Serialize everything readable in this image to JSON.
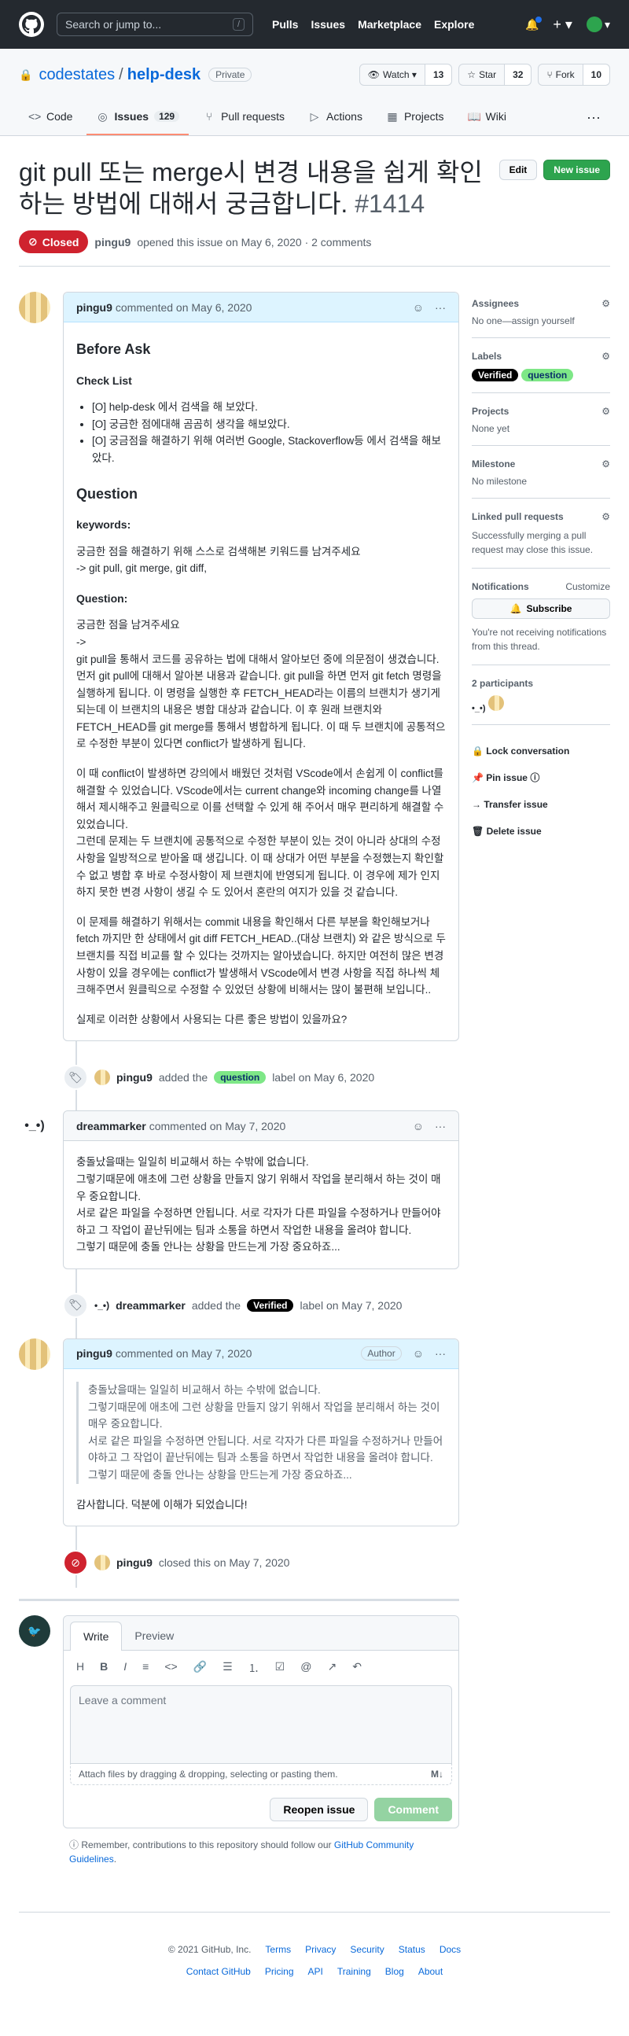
{
  "topbar": {
    "search_placeholder": "Search or jump to...",
    "slash": "/",
    "nav": [
      "Pulls",
      "Issues",
      "Marketplace",
      "Explore"
    ]
  },
  "repo": {
    "owner": "codestates",
    "sep": "/",
    "name": "help-desk",
    "visibility": "Private",
    "watch_label": "Watch",
    "watch_count": "13",
    "star_label": "Star",
    "star_count": "32",
    "fork_label": "Fork",
    "fork_count": "10",
    "tabs": [
      {
        "label": "Code",
        "icon": "<>"
      },
      {
        "label": "Issues",
        "icon": "◎",
        "count": "129"
      },
      {
        "label": "Pull requests",
        "icon": "⑂"
      },
      {
        "label": "Actions",
        "icon": "▷"
      },
      {
        "label": "Projects",
        "icon": "▦"
      },
      {
        "label": "Wiki",
        "icon": "📖"
      }
    ]
  },
  "issue": {
    "title": "git pull 또는 merge시 변경 내용을 쉽게 확인하는 방법에 대해서 궁금합니다.",
    "number": "#1414",
    "edit_label": "Edit",
    "new_label": "New issue",
    "state": "Closed",
    "author": "pingu9",
    "meta": "opened this issue on May 6, 2020 · 2 comments"
  },
  "comments": {
    "c1": {
      "author": "pingu9",
      "date": "commented on May 6, 2020",
      "h_before": "Before Ask",
      "h_check": "Check List",
      "checks": [
        "[O] help-desk 에서 검색을 해 보았다.",
        "[O] 궁금한 점에대해 곰곰히 생각을 해보았다.",
        "[O] 궁금점을 해결하기 위해 여러번 Google, Stackoverflow등 에서 검색을 해보았다."
      ],
      "h_question": "Question",
      "kw_label": "keywords:",
      "kw_1": "궁금한 점을 해결하기 위해 스스로 검색해본 키워드를 남겨주세요",
      "kw_2": "-> git pull, git merge, git diff,",
      "q_label": "Question:",
      "q_1": "궁금한 점을 남겨주세요",
      "q_2": "->",
      "p1": "git pull을 통해서 코드를 공유하는 법에 대해서 알아보던 중에 의문점이 생겼습니다. 먼저 git pull에 대해서 알아본 내용과 같습니다. git pull을 하면 먼저 git fetch 명령을 실행하게 됩니다. 이 명령을 실행한 후 FETCH_HEAD라는 이름의 브랜치가 생기게 되는데 이 브랜치의 내용은 병합 대상과 같습니다. 이 후 원래 브랜치와 FETCH_HEAD를 git merge를 통해서 병합하게 됩니다. 이 때 두 브랜치에 공통적으로 수정한 부분이 있다면 conflict가 발생하게 됩니다.",
      "p2": "이 때 conflict이 발생하면 강의에서 배웠던 것처럼 VScode에서 손쉽게 이 conflict를 해결할 수 있었습니다. VScode에서는 current change와 incoming change를 나열해서 제시해주고 원클릭으로 이를 선택할 수 있게 해 주어서 매우 편리하게 해결할 수 있었습니다.",
      "p3": "그런데 문제는 두 브랜치에 공통적으로 수정한 부분이 있는 것이 아니라 상대의 수정 사항을 일방적으로 받아올 때 생깁니다. 이 때 상대가 어떤 부분을 수정했는지 확인할 수 없고 병합 후 바로 수정사항이 제 브랜치에 반영되게 됩니다. 이 경우에 제가 인지하지 못한 변경 사항이 생길 수 도 있어서 혼란의 여지가 있을 것 같습니다.",
      "p4": "이 문제를 해결하기 위해서는 commit 내용을 확인해서 다른 부분을 확인해보거나 fetch 까지만 한 상태에서 git diff FETCH_HEAD..(대상 브랜치) 와 같은 방식으로 두 브랜치를 직접 비교를 할 수 있다는 것까지는 알아냈습니다. 하지만 여전히 많은 변경사항이 있을 경우에는 conflict가 발생해서 VScode에서 변경 사항을 직접 하나씩 체크해주면서 원클릭으로 수정할 수 있었던 상황에 비해서는 많이 불편해 보입니다..",
      "p5": "실제로 이러한 상황에서 사용되는 다른 좋은 방법이 있을까요?"
    },
    "e1": {
      "author": "pingu9",
      "pre": "added the",
      "label": "question",
      "post": "label on May 6, 2020"
    },
    "c2": {
      "author": "dreammarker",
      "date": "commented on May 7, 2020",
      "lines": [
        "충돌났을때는 일일히 비교해서 하는 수밖에 없습니다.",
        "그렇기때문에 애초에 그런 상황을 만들지 않기 위해서 작업을 분리해서 하는 것이 매우 중요합니다.",
        "서로 같은 파일을 수정하면 안됩니다. 서로 각자가 다른 파일을 수정하거나 만들어야하고 그 작업이 끝난뒤에는 팀과 소통을 하면서 작업한 내용을 올려야 합니다.",
        "그렇기 때문에 충돌 안나는 상황을 만드는게 가장 중요하죠..."
      ]
    },
    "e2": {
      "author": "dreammarker",
      "pre": "added the",
      "label": "Verified",
      "post": "label on May 7, 2020"
    },
    "c3": {
      "author": "pingu9",
      "date": "commented on May 7, 2020",
      "role": "Author",
      "quote": [
        "충돌났을때는 일일히 비교해서 하는 수밖에 없습니다.",
        "그렇기때문에 애초에 그런 상황을 만들지 않기 위해서 작업을 분리해서 하는 것이 매우 중요합니다.",
        "서로 같은 파일을 수정하면 안됩니다. 서로 각자가 다른 파일을 수정하거나 만들어야하고 그 작업이 끝난뒤에는 팀과 소통을 하면서 작업한 내용을 올려야 합니다.",
        "그렇기 때문에 충돌 안나는 상황을 만드는게 가장 중요하죠..."
      ],
      "reply": "감사합니다. 덕분에 이해가 되었습니다!"
    },
    "e3": {
      "author": "pingu9",
      "text": "closed this on May 7, 2020"
    }
  },
  "editor": {
    "tab_write": "Write",
    "tab_preview": "Preview",
    "toolbar": [
      "H",
      "B",
      "I",
      "≡",
      "<>",
      "🔗",
      "☰",
      "⒈",
      "☑",
      "@",
      "↗",
      "↶"
    ],
    "placeholder": "Leave a comment",
    "attach": "Attach files by dragging & dropping, selecting or pasting them.",
    "md": "M↓",
    "reopen": "Reopen issue",
    "submit": "Comment",
    "note_pre": "Remember, contributions to this repository should follow our",
    "note_link": "GitHub Community Guidelines",
    "note_post": "."
  },
  "sidebar": {
    "assignees_h": "Assignees",
    "assignees_v": "No one—assign yourself",
    "labels_h": "Labels",
    "labels": [
      {
        "name": "Verified",
        "color": "#000000"
      },
      {
        "name": "question",
        "color": "#7ee787"
      }
    ],
    "projects_h": "Projects",
    "projects_v": "None yet",
    "milestone_h": "Milestone",
    "milestone_v": "No milestone",
    "linked_h": "Linked pull requests",
    "linked_v": "Successfully merging a pull request may close this issue.",
    "notif_h": "Notifications",
    "notif_customize": "Customize",
    "subscribe": "Subscribe",
    "notif_v": "You're not receiving notifications from this thread.",
    "participants_h": "2 participants",
    "actions": [
      "Lock conversation",
      "Pin issue",
      "Transfer issue",
      "Delete issue"
    ]
  },
  "footer": {
    "copyright": "© 2021 GitHub, Inc.",
    "row1": [
      "Terms",
      "Privacy",
      "Security",
      "Status",
      "Docs"
    ],
    "row2": [
      "Contact GitHub",
      "Pricing",
      "API",
      "Training",
      "Blog",
      "About"
    ]
  }
}
